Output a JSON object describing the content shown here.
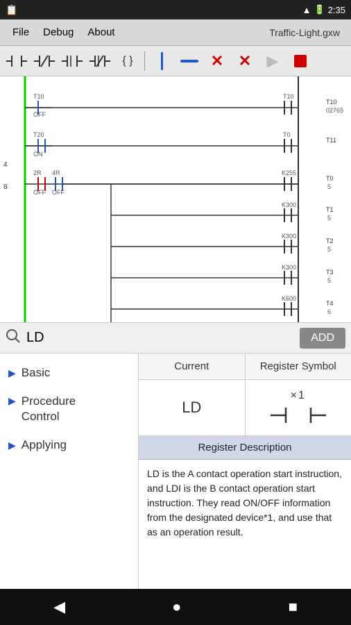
{
  "status_bar": {
    "time": "2:35",
    "battery_icon": "🔋",
    "wifi_icon": "📶",
    "signal_icon": "📡"
  },
  "menu": {
    "items": [
      "File",
      "Debug",
      "About"
    ],
    "title": "Traffic-Light.gxw"
  },
  "toolbar": {
    "buttons": [
      {
        "name": "contact-a",
        "symbol": "┤├",
        "label": "Contact A"
      },
      {
        "name": "contact-b",
        "symbol": "┤/├",
        "label": "Contact B"
      },
      {
        "name": "coil-a",
        "symbol": "┤├",
        "label": "Coil A"
      },
      {
        "name": "coil-b",
        "symbol": "┤/├",
        "label": "Coil B"
      },
      {
        "name": "func",
        "symbol": "{ }",
        "label": "Function"
      }
    ]
  },
  "search": {
    "value": "LD",
    "placeholder": "Search",
    "add_label": "ADD"
  },
  "sidebar": {
    "items": [
      {
        "id": "basic",
        "label": "Basic"
      },
      {
        "id": "procedure-control",
        "label": "Procedure Control"
      },
      {
        "id": "applying",
        "label": "Applying"
      }
    ]
  },
  "register_panel": {
    "headers": [
      "Current",
      "Register Symbol"
    ],
    "current_value": "LD",
    "symbol_x1": "×1",
    "description_header": "Register Description",
    "description_text": "LD is the A contact operation start instruction, and LDI is the B contact operation start instruction. They read ON/OFF information from the designated device*1, and use that as an operation result."
  },
  "nav_bar": {
    "back": "◀",
    "home": "●",
    "recent": "■"
  },
  "colors": {
    "accent_blue": "#2255cc",
    "accent_red": "#cc0000",
    "toolbar_bg": "#e8e8e8",
    "ladder_green": "#00cc00",
    "sidebar_bg": "#ffffff",
    "header_bg": "#d0d8e8"
  }
}
